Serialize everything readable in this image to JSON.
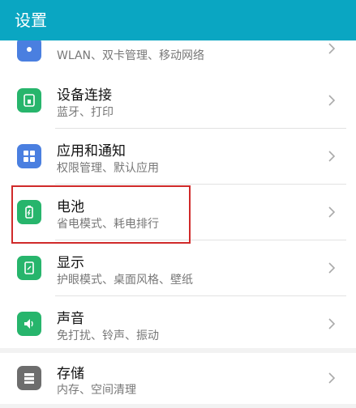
{
  "header": {
    "title": "设置"
  },
  "items": [
    {
      "title": "",
      "subtitle": "WLAN、双卡管理、移动网络",
      "icon": "network-icon",
      "color": "#4a7fe0"
    },
    {
      "title": "设备连接",
      "subtitle": "蓝牙、打印",
      "icon": "device-connect-icon",
      "color": "#27b56c"
    },
    {
      "title": "应用和通知",
      "subtitle": "权限管理、默认应用",
      "icon": "apps-icon",
      "color": "#4a7fe0"
    },
    {
      "title": "电池",
      "subtitle": "省电模式、耗电排行",
      "icon": "battery-icon",
      "color": "#27b56c"
    },
    {
      "title": "显示",
      "subtitle": "护眼模式、桌面风格、壁纸",
      "icon": "display-icon",
      "color": "#27b56c"
    },
    {
      "title": "声音",
      "subtitle": "免打扰、铃声、振动",
      "icon": "sound-icon",
      "color": "#27b56c"
    },
    {
      "title": "存储",
      "subtitle": "内存、空间清理",
      "icon": "storage-icon",
      "color": "#6d6d6d"
    }
  ],
  "colors": {
    "header": "#0aa6c2",
    "highlight": "#d02a2a"
  }
}
